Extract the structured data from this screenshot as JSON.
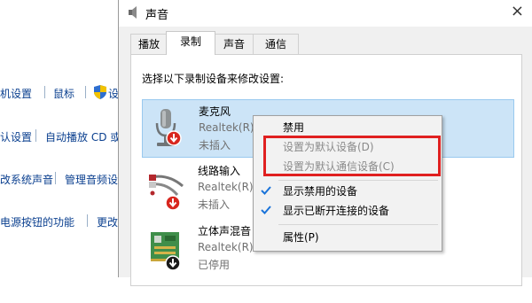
{
  "background": {
    "links": [
      {
        "text": "机设置"
      },
      {
        "text": "鼠标"
      },
      {
        "text": "设"
      },
      {
        "text": "认设置"
      },
      {
        "text": "自动播放 CD 或"
      },
      {
        "text": "改系统声音"
      },
      {
        "text": "管理音频设"
      },
      {
        "text": "电源按钮的功能"
      },
      {
        "text": "更改"
      }
    ]
  },
  "dialog": {
    "title": "声音",
    "close": "×",
    "tabs": [
      {
        "label": "播放"
      },
      {
        "label": "录制"
      },
      {
        "label": "声音"
      },
      {
        "label": "通信"
      }
    ],
    "instruction": "选择以下录制设备来修改设置:",
    "devices": [
      {
        "name": "麦克风",
        "driver": "Realtek(R)",
        "status": "未插入",
        "icon": "microphone-icon"
      },
      {
        "name": "线路输入",
        "driver": "Realtek(R)",
        "status": "未插入",
        "icon": "line-in-icon"
      },
      {
        "name": "立体声混音",
        "driver": "Realtek(R)",
        "status": "已停用",
        "icon": "stereo-mix-icon"
      }
    ]
  },
  "context_menu": {
    "items": [
      {
        "label": "禁用",
        "enabled": true,
        "checked": false
      },
      {
        "label": "设置为默认设备(D)",
        "enabled": false,
        "checked": false
      },
      {
        "label": "设置为默认通信设备(C)",
        "enabled": false,
        "checked": false
      },
      {
        "label": "显示禁用的设备",
        "enabled": true,
        "checked": true
      },
      {
        "label": "显示已断开连接的设备",
        "enabled": true,
        "checked": true
      },
      {
        "label": "属性(P)",
        "enabled": true,
        "checked": false
      }
    ]
  },
  "colors": {
    "highlight_box": "#e02020",
    "selection": "#cce4f7",
    "check": "#1a73d9",
    "status_red": "#e02020"
  }
}
